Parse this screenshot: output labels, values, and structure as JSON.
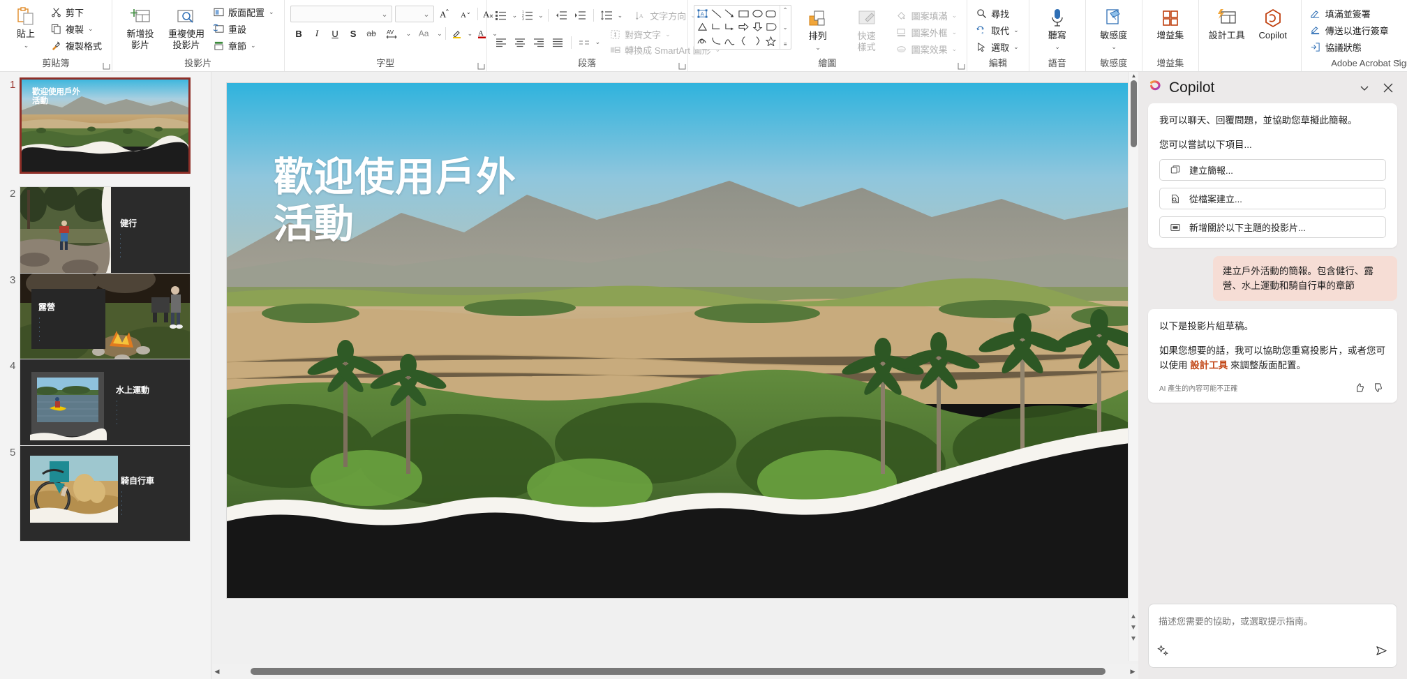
{
  "ribbon": {
    "groups": [
      {
        "label": "剪貼簿",
        "paste_label_1": "貼上",
        "items": [
          {
            "label": "剪下",
            "icon": "scissors-icon"
          },
          {
            "label": "複製",
            "icon": "copy-icon",
            "chevron": "⌄"
          },
          {
            "label": "複製格式",
            "icon": "format-painter-icon"
          }
        ]
      },
      {
        "label": "投影片",
        "new_slide_1": "新增投",
        "new_slide_2": "影片",
        "reuse_1": "重複使用",
        "reuse_2": "投影片",
        "items": [
          {
            "label": "版面配置",
            "icon": "layout-icon",
            "chevron": "⌄"
          },
          {
            "label": "重設",
            "icon": "reset-icon"
          },
          {
            "label": "章節",
            "icon": "section-icon",
            "chevron": "⌄"
          }
        ]
      },
      {
        "label": "字型",
        "font_name_value": "",
        "font_size_value": "",
        "buttons": [
          "B",
          "I",
          "U",
          "S",
          "ab",
          "AV",
          "Aa"
        ]
      },
      {
        "label": "段落",
        "items": [
          {
            "label": "文字方向",
            "icon": "text-direction-icon",
            "chevron": "⌄"
          },
          {
            "label": "對齊文字",
            "icon": "align-text-icon",
            "chevron": "⌄"
          },
          {
            "label": "轉換成 SmartArt 圖形",
            "icon": "smartart-icon",
            "chevron": "⌄"
          }
        ]
      },
      {
        "label": "繪圖",
        "arrange_label": "排列",
        "quickstyle_1": "快速",
        "quickstyle_2": "樣式",
        "items": [
          {
            "label": "圖案填滿",
            "icon": "shape-fill-icon",
            "chevron": "⌄"
          },
          {
            "label": "圖案外框",
            "icon": "shape-outline-icon",
            "chevron": "⌄"
          },
          {
            "label": "圖案效果",
            "icon": "shape-effects-icon",
            "chevron": "⌄"
          }
        ]
      },
      {
        "label": "編輯",
        "items": [
          {
            "label": "尋找",
            "icon": "search-icon"
          },
          {
            "label": "取代",
            "icon": "replace-icon",
            "chevron": "⌄"
          },
          {
            "label": "選取",
            "icon": "select-icon",
            "chevron": "⌄"
          }
        ]
      },
      {
        "label": "語音",
        "big": "聽寫",
        "chevron": "⌄",
        "icon": "microphone-icon"
      },
      {
        "label": "敏感度",
        "big": "敏感度",
        "chevron": "⌄",
        "icon": "sensitivity-icon"
      },
      {
        "label": "增益集",
        "big": "增益集",
        "icon": "addins-icon"
      },
      {
        "label": "",
        "designer": "設計工具",
        "copilot": "Copilot"
      }
    ],
    "adobe": {
      "title": "Adobe Acrobat Sign",
      "items": [
        {
          "label": "填滿並簽署",
          "icon": "fill-sign-icon"
        },
        {
          "label": "傳送以進行簽章",
          "icon": "send-for-signature-icon"
        },
        {
          "label": "協議狀態",
          "icon": "agreement-status-icon"
        }
      ]
    },
    "collapse_chevron": "⌄"
  },
  "slides": [
    {
      "num": "1",
      "title": "歡迎使用戶外\n活動",
      "selected": true,
      "kind": "title-photo"
    },
    {
      "num": "2",
      "title": "健行",
      "selected": false,
      "kind": "photo-left"
    },
    {
      "num": "3",
      "title": "露營",
      "selected": false,
      "kind": "photo-full"
    },
    {
      "num": "4",
      "title": "水上運動",
      "selected": false,
      "kind": "photo-inset"
    },
    {
      "num": "5",
      "title": "騎自行車",
      "selected": false,
      "kind": "photo-inset-bike"
    }
  ],
  "canvas": {
    "slide_title": "歡迎使用戶外\n活動"
  },
  "copilot": {
    "title": "Copilot",
    "collapse_icon": "chevron-down-icon",
    "close_icon": "close-icon",
    "intro_p1": "我可以聊天、回覆問題，並協助您草擬此簡報。",
    "intro_p2": "您可以嘗試以下項目...",
    "suggestions": [
      {
        "label": "建立簡報...",
        "icon": "copy-slide-icon"
      },
      {
        "label": "從檔案建立...",
        "icon": "file-search-icon"
      },
      {
        "label": "新增關於以下主題的投影片...",
        "icon": "add-slide-icon"
      }
    ],
    "user_message": "建立戶外活動的簡報。包含健行、露營、水上運動和騎自行車的章節",
    "reply_p1": "以下是投影片組草稿。",
    "reply_p2_a": "如果您想要的話，我可以協助您重寫投影片，或者您可以使用 ",
    "reply_link": "設計工具",
    "reply_p2_b": " 來調整版面配置。",
    "ai_disclaimer": "AI 產生的內容可能不正確",
    "thumbs_up_icon": "thumbs-up-icon",
    "thumbs_down_icon": "thumbs-down-icon",
    "input_placeholder": "描述您需要的協助，或選取提示指南。",
    "prompt_guide_icon": "sparkle-icon",
    "send_icon": "send-icon",
    "user_bubble_color": "#f6ddd5",
    "link_color": "#c0400f"
  },
  "scroll": {
    "v_up": "▲",
    "v_down": "▼",
    "h_left": "◀",
    "h_right": "▶",
    "prev_slide": "▲",
    "next_slide": "▼",
    "menu": "▼"
  }
}
